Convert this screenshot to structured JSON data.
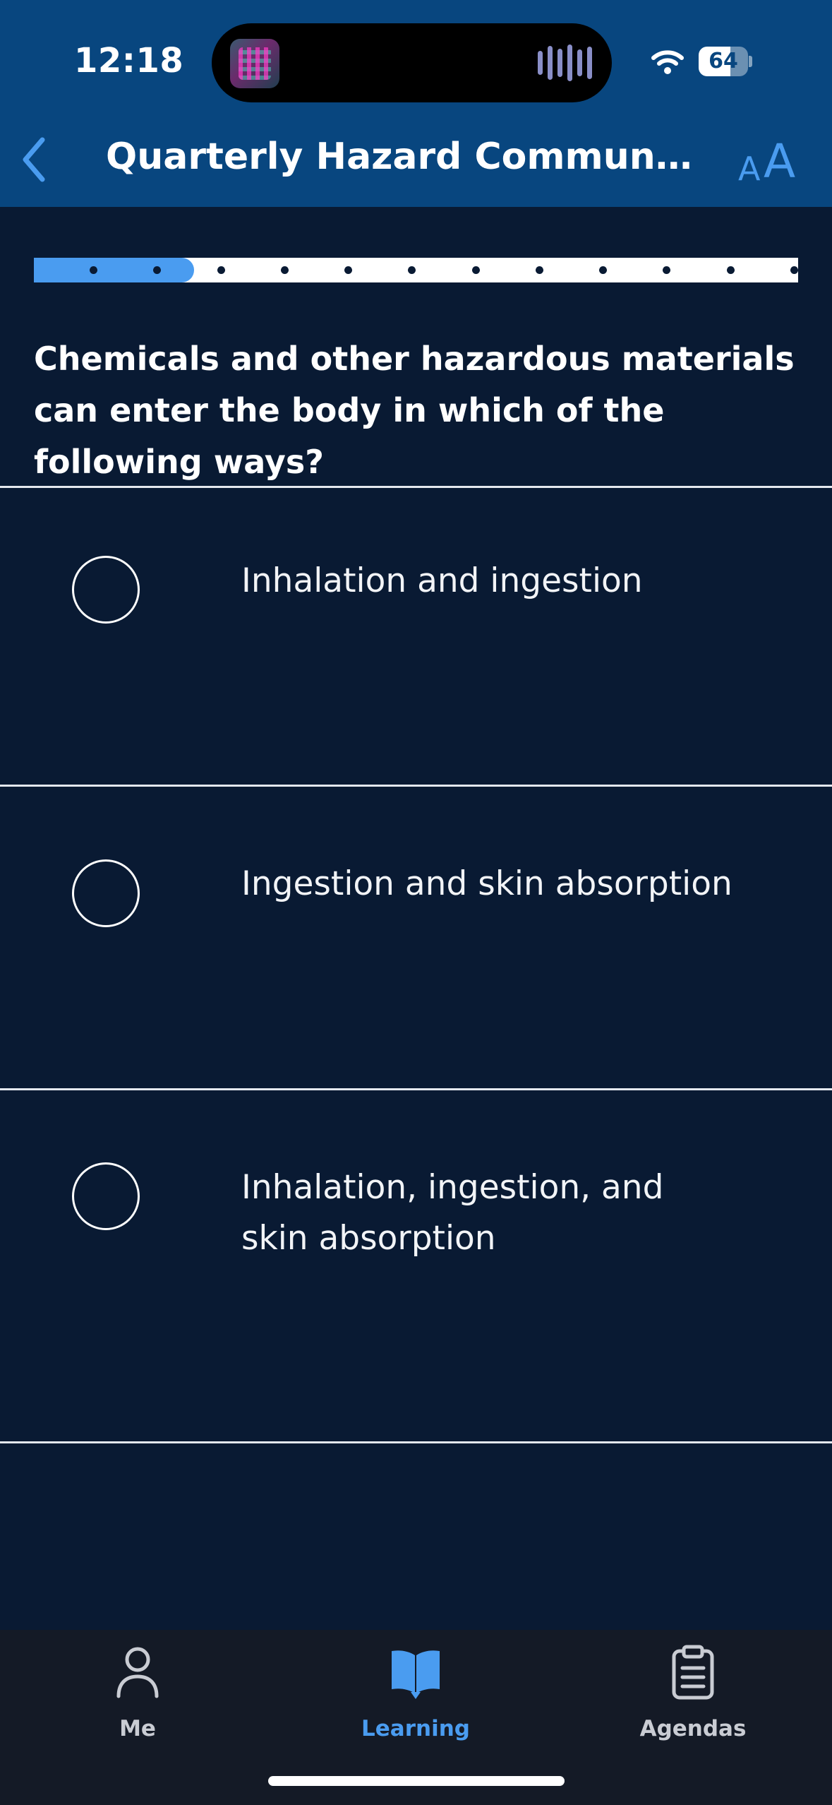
{
  "status_bar": {
    "time": "12:18",
    "battery": "64",
    "icons": [
      "now-playing-art-icon",
      "audio-waveform-icon",
      "wifi-icon",
      "battery-icon"
    ]
  },
  "nav": {
    "back_icon": "chevron-left-icon",
    "title": "Quarterly Hazard Communicatio...",
    "text_size_icon": "text-size-icon",
    "text_size_small": "A",
    "text_size_big": "A"
  },
  "progress": {
    "total_questions": 12,
    "completed_fraction": 0.21,
    "fill_color": "#4a9cf0",
    "track_color": "#ffffff"
  },
  "question": {
    "text": "Chemicals and other hazardous materials can enter the body in which of the following ways?"
  },
  "options": [
    {
      "label": "Inhalation and ingestion",
      "selected": false
    },
    {
      "label": "Ingestion and skin absorption",
      "selected": false
    },
    {
      "label": "Inhalation, ingestion, and skin absorption",
      "selected": false
    }
  ],
  "tabbar": {
    "tabs": [
      {
        "label": "Me",
        "icon": "person-icon",
        "active": false
      },
      {
        "label": "Learning",
        "icon": "book-icon",
        "active": true
      },
      {
        "label": "Agendas",
        "icon": "clipboard-icon",
        "active": false
      }
    ],
    "active_color": "#4a9cf0",
    "inactive_color": "#c9ccd3"
  },
  "colors": {
    "header_bg": "#08467f",
    "page_bg": "#091a33",
    "tabbar_bg": "#141a26",
    "accent": "#4a9cf0"
  }
}
